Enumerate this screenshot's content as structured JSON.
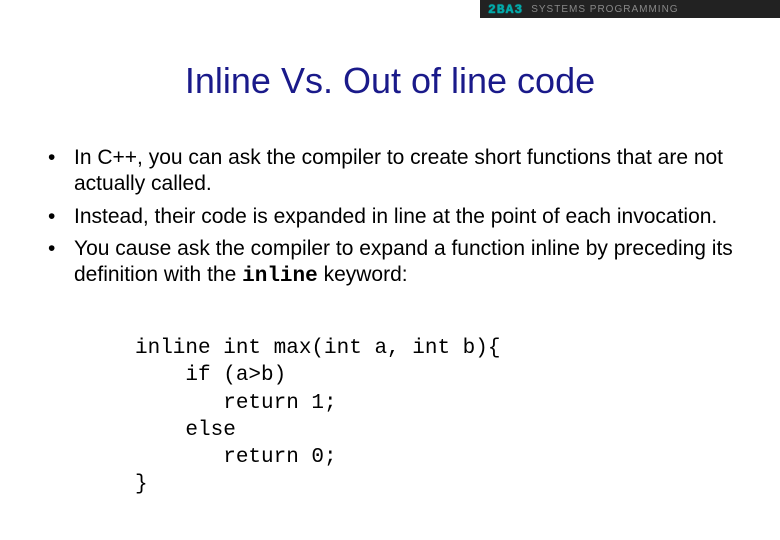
{
  "header": {
    "left": "2BA3",
    "right": "Systems Programming"
  },
  "title": "Inline Vs. Out of line code",
  "bullets": [
    {
      "pre": "In C++, you can ask the compiler to create short functions that are not actually called.",
      "kw": "",
      "post": ""
    },
    {
      "pre": "Instead, their code is expanded in line at the point of each invocation.",
      "kw": "",
      "post": ""
    },
    {
      "pre": "You cause ask the compiler to expand a function inline by preceding its definition with the ",
      "kw": "inline",
      "post": " keyword:"
    }
  ],
  "code": "inline int max(int a, int b){\n    if (a>b)\n       return 1;\n    else\n       return 0;\n}"
}
